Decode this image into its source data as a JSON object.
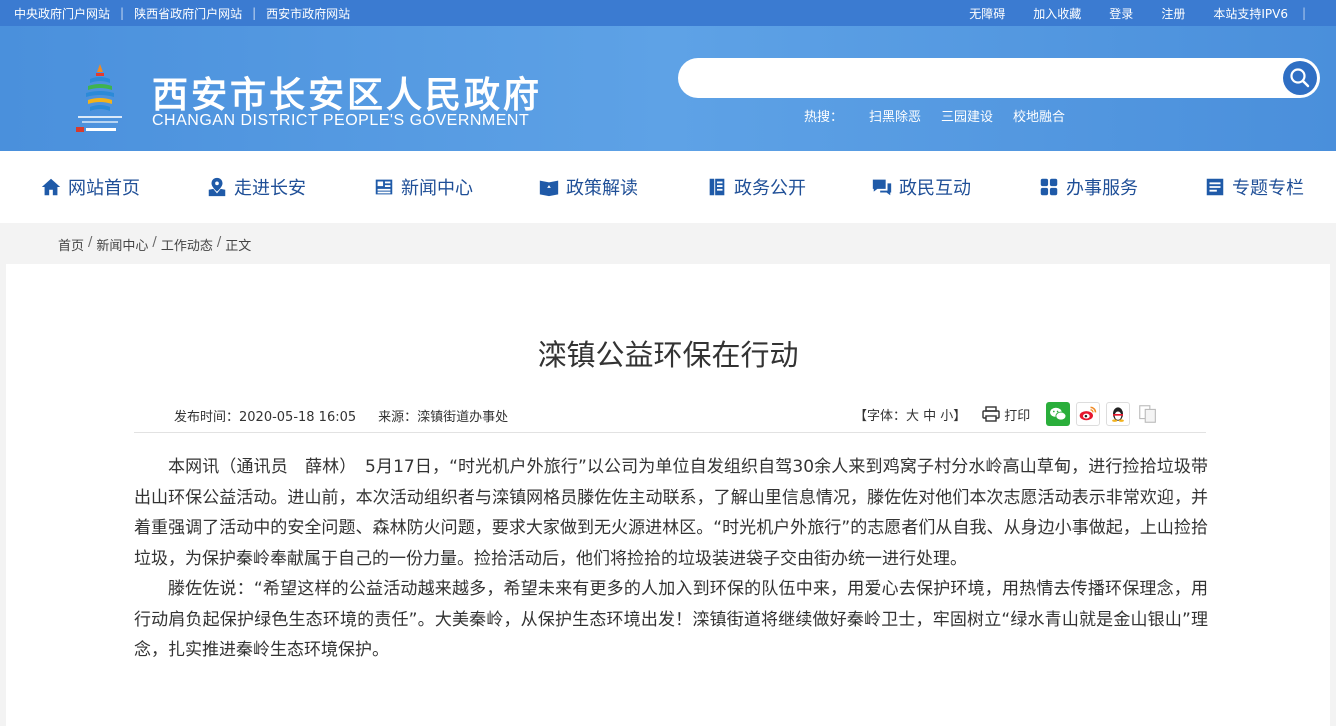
{
  "topbar": {
    "links_left": [
      "中央政府门户网站",
      "陕西省政府门户网站",
      "西安市政府网站"
    ],
    "links_right": [
      "无障碍",
      "加入收藏",
      "登录",
      "注册",
      "本站支持IPV6"
    ]
  },
  "header": {
    "title": "西安市长安区人民政府",
    "subtitle": "CHANGAN DISTRICT PEOPLE'S GOVERNMENT",
    "search_placeholder": "",
    "hot_label": "热搜：",
    "hot_items": [
      "扫黑除恶",
      "三园建设",
      "校地融合"
    ]
  },
  "nav": [
    {
      "label": "网站首页",
      "icon": "home-icon"
    },
    {
      "label": "走进长安",
      "icon": "map-icon"
    },
    {
      "label": "新闻中心",
      "icon": "news-icon"
    },
    {
      "label": "政策解读",
      "icon": "book-icon"
    },
    {
      "label": "政务公开",
      "icon": "document-icon"
    },
    {
      "label": "政民互动",
      "icon": "chat-icon"
    },
    {
      "label": "办事服务",
      "icon": "grid-icon"
    },
    {
      "label": "专题专栏",
      "icon": "list-icon"
    }
  ],
  "breadcrumb": [
    "首页",
    "新闻中心",
    "工作动态",
    "正文"
  ],
  "article": {
    "title": "滦镇公益环保在行动",
    "publish_label": "发布时间：2020-05-18 16:05",
    "source_label": "来源：滦镇街道办事处",
    "font_size_label": "【字体：大 中 小】",
    "print_label": "打印",
    "paragraphs": [
      "本网讯（通讯员　薛林）　5月17日，“时光机户外旅行”以公司为单位自发组织自驾30余人来到鸡窝子村分水岭高山草甸，进行捡拾垃圾带出山环保公益活动。进山前，本次活动组织者与滦镇网格员滕佐佐主动联系，了解山里信息情况，滕佐佐对他们本次志愿活动表示非常欢迎，并着重强调了活动中的安全问题、森林防火问题，要求大家做到无火源进林区。“时光机户外旅行”的志愿者们从自我、从身边小事做起，上山捡拾垃圾，为保护秦岭奉献属于自己的一份力量。捡拾活动后，他们将捡拾的垃圾装进袋子交由街办统一进行处理。",
      "滕佐佐说：“希望这样的公益活动越来越多，希望未来有更多的人加入到环保的队伍中来，用爱心去保护环境，用热情去传播环保理念，用行动肩负起保护绿色生态环境的责任”。大美秦岭，从保护生态环境出发！滦镇街道将继续做好秦岭卫士，牢固树立“绿水青山就是金山银山”理念，扎实推进秦岭生态环境保护。"
    ]
  },
  "colors": {
    "topbar": "#3b7bd1",
    "header": "#5ea2e6",
    "nav_text": "#1f4f97",
    "wechat": "#2aae3b",
    "weibo": "#e6162d",
    "qq": "#1e90ff"
  }
}
